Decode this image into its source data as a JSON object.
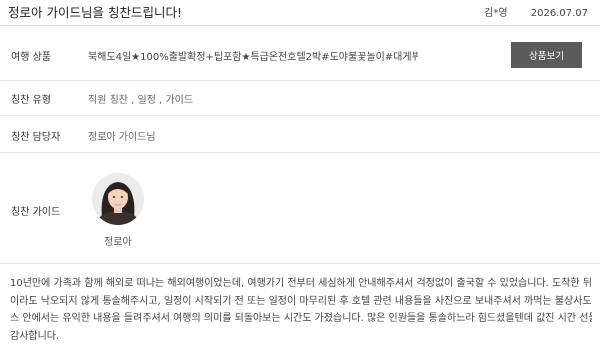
{
  "header": {
    "title": "정로아 가이드님을 칭찬드립니다!",
    "author": "김*영",
    "date": "2026.07.07"
  },
  "rows": {
    "product": {
      "label": "여행 상품",
      "value": "북해도4일★100%출발확정+팁포함★특급온천호텔2박#도야불꽃놀이#대게뷔페+...",
      "button_label": "상품보기"
    },
    "praise_type": {
      "label": "칭찬 유형",
      "value": "직원 칭찬 , 일정 , 가이드"
    },
    "praise_target": {
      "label": "칭찬 담당자",
      "value": "정로아 가이드님"
    },
    "praise_guide": {
      "label": "칭찬 가이드",
      "guide_name": "정로아"
    }
  },
  "review": {
    "lines": [
      "10년만에 가족과 함께 해외로 떠나는 해외여행이었는데, 여행가기 전부터 세심하게 안내해주셔서 걱정없이 출국할 수 있었습니다. 도착한 뒤로는 한 명",
      "이라도 낙오되지 않게 통솔해주시고, 일정이 시작되기 전 또는 일정이 마무리된 후 호텔 관련 내용들을 사진으로 보내주셔서 까먹는 불상사도 없었죠. 버",
      "스 안에서는 유익한 내용을 들려주셔서 여행의 의미를 되돌아보는 시간도 가졌습니다. 많은 인원들을 통솔하느라 힘드셨을텐데 값진 시간 선물해주셔서",
      "감사합니다."
    ]
  }
}
